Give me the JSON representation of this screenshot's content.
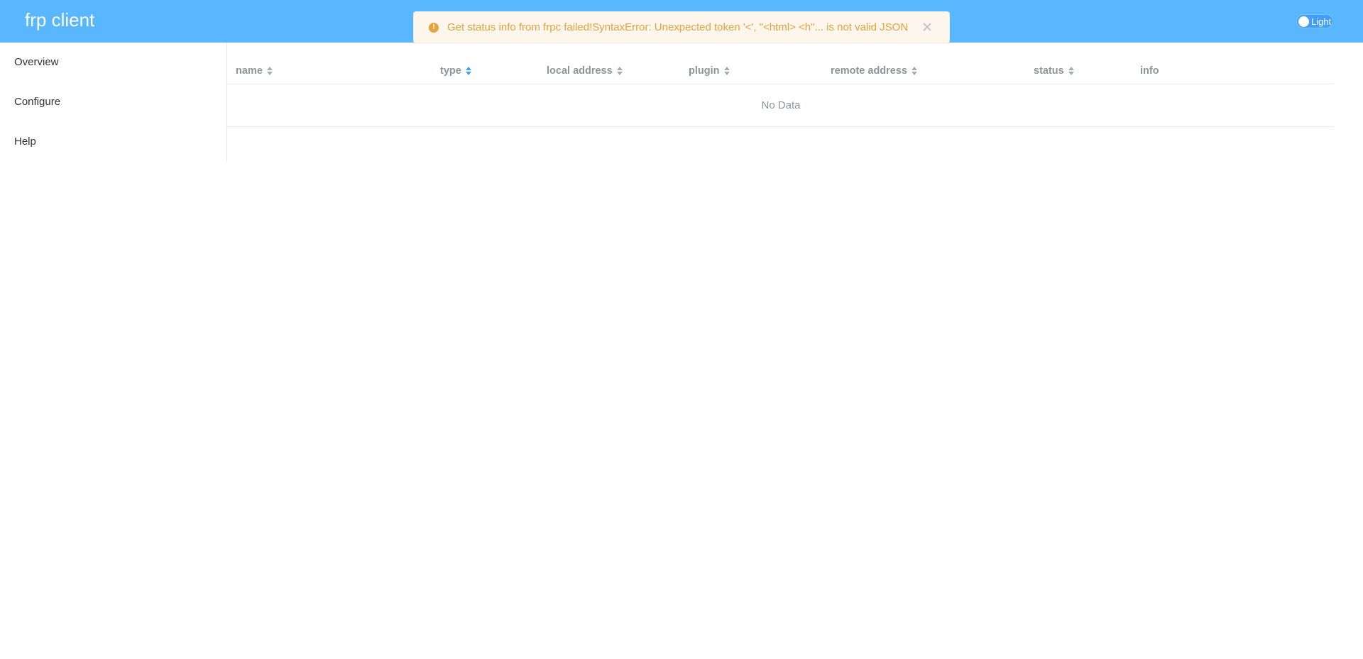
{
  "header": {
    "title": "frp client",
    "theme_label": "Light"
  },
  "message": {
    "text": "Get status info from frpc failed!SyntaxError: Unexpected token '<', \"<html> <h\"... is not valid JSON",
    "type": "warning",
    "color": "#e6a23c"
  },
  "sidebar": {
    "items": [
      {
        "label": "Overview"
      },
      {
        "label": "Configure"
      },
      {
        "label": "Help"
      }
    ]
  },
  "table": {
    "columns": [
      {
        "label": "name",
        "sortable": true,
        "active": false
      },
      {
        "label": "type",
        "sortable": true,
        "active": true
      },
      {
        "label": "local address",
        "sortable": true,
        "active": false
      },
      {
        "label": "plugin",
        "sortable": true,
        "active": false
      },
      {
        "label": "remote address",
        "sortable": true,
        "active": false
      },
      {
        "label": "status",
        "sortable": true,
        "active": false
      },
      {
        "label": "info",
        "sortable": false,
        "active": false
      }
    ],
    "empty_text": "No Data"
  },
  "colors": {
    "header_bg": "#58b7ff",
    "accent": "#409eff",
    "warning": "#e6a23c"
  }
}
